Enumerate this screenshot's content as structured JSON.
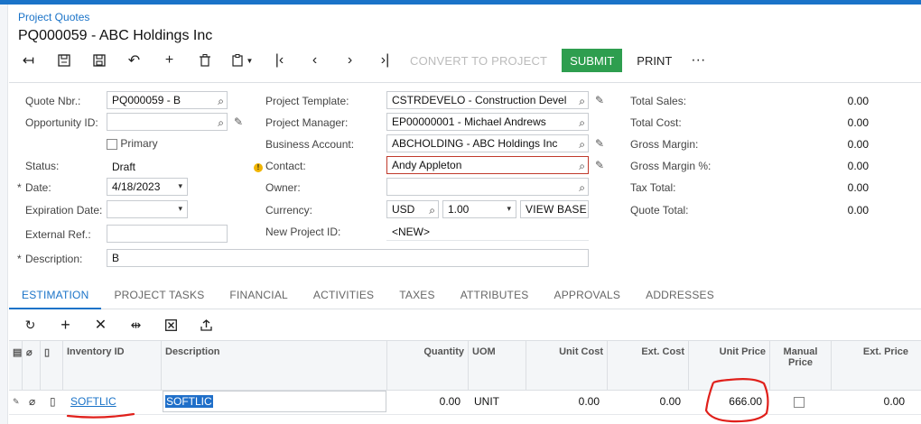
{
  "breadcrumb": "Project Quotes",
  "page_title": "PQ000059 - ABC Holdings Inc",
  "toolbar": {
    "convert": "CONVERT TO PROJECT",
    "submit": "SUBMIT",
    "print": "PRINT",
    "more": "···"
  },
  "form": {
    "quote_nbr": {
      "label": "Quote Nbr.:",
      "value": "PQ000059 - B"
    },
    "opportunity_id": {
      "label": "Opportunity ID:",
      "value": ""
    },
    "primary": {
      "label": "Primary"
    },
    "status": {
      "label": "Status:",
      "value": "Draft"
    },
    "date": {
      "label": "Date:",
      "value": "4/18/2023"
    },
    "expiration_date": {
      "label": "Expiration Date:",
      "value": ""
    },
    "external_ref": {
      "label": "External Ref.:",
      "value": ""
    },
    "description": {
      "label": "Description:",
      "value": "B"
    },
    "project_template": {
      "label": "Project Template:",
      "value": "CSTRDEVELO - Construction Devel"
    },
    "project_manager": {
      "label": "Project Manager:",
      "value": "EP00000001 - Michael Andrews"
    },
    "business_account": {
      "label": "Business Account:",
      "value": "ABCHOLDING - ABC Holdings Inc"
    },
    "contact": {
      "label": "Contact:",
      "value": "Andy Appleton"
    },
    "owner": {
      "label": "Owner:",
      "value": ""
    },
    "currency": {
      "label": "Currency:",
      "code": "USD",
      "rate": "1.00",
      "view_base": "VIEW BASE"
    },
    "new_project_id": {
      "label": "New Project ID:",
      "value": "<NEW>"
    }
  },
  "totals": {
    "total_sales": {
      "label": "Total Sales:",
      "value": "0.00"
    },
    "total_cost": {
      "label": "Total Cost:",
      "value": "0.00"
    },
    "gross_margin": {
      "label": "Gross Margin:",
      "value": "0.00"
    },
    "gross_margin_pct": {
      "label": "Gross Margin %:",
      "value": "0.00"
    },
    "tax_total": {
      "label": "Tax Total:",
      "value": "0.00"
    },
    "quote_total": {
      "label": "Quote Total:",
      "value": "0.00"
    }
  },
  "tabs": [
    "ESTIMATION",
    "PROJECT TASKS",
    "FINANCIAL",
    "ACTIVITIES",
    "TAXES",
    "ATTRIBUTES",
    "APPROVALS",
    "ADDRESSES"
  ],
  "grid": {
    "headers": {
      "inventory_id": "Inventory ID",
      "description": "Description",
      "quantity": "Quantity",
      "uom": "UOM",
      "unit_cost": "Unit Cost",
      "ext_cost": "Ext. Cost",
      "unit_price": "Unit Price",
      "manual_price": "Manual Price",
      "ext_price": "Ext. Price"
    },
    "rows": [
      {
        "inventory_id": "SOFTLIC",
        "description": "SOFTLIC",
        "quantity": "0.00",
        "uom": "UNIT",
        "unit_cost": "0.00",
        "ext_cost": "0.00",
        "unit_price": "666.00",
        "ext_price": "0.00"
      }
    ]
  },
  "colors": {
    "accent": "#1a73c8",
    "submit": "#2e9e4f",
    "annotation": "#e0201b"
  }
}
